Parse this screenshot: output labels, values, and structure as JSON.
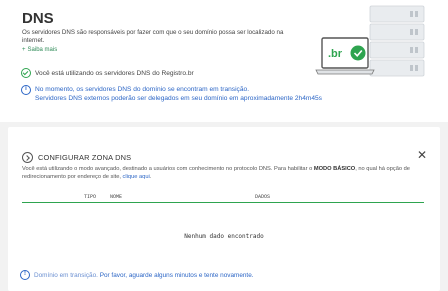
{
  "page": {
    "title": "DNS",
    "description": "Os servidores DNS são responsáveis por fazer com que o seu domínio possa ser localizado na internet.",
    "more_label": "Saiba mais",
    "more_prefix": "+",
    "status_text": "Você está utilizando os servidores DNS do Registro.br",
    "transition_line1": "No momento, os servidores DNS do domínio se encontram em transição.",
    "transition_line2": "Servidores DNS externos poderão ser delegados em seu domínio em aproximadamente 2h4m45s"
  },
  "illustration": {
    "br_label": ".br",
    "accent": "#2ea44f"
  },
  "modal": {
    "title": "CONFIGURAR ZONA DNS",
    "close_glyph": "✕",
    "desc_part1": "Você está utilizando o modo avançado, destinado a usuários com conhecimento no protocolo DNS. Para habilitar o ",
    "desc_bold": "MODO BÁSICO",
    "desc_part2": ", no qual há opção de redirecionamento por endereço de site, ",
    "desc_link": "clique aqui",
    "desc_end": ".",
    "table": {
      "columns": [
        "TIPO",
        "NOME",
        "DADOS"
      ]
    },
    "empty_text": "Nenhum dado encontrado",
    "footer_part1": "Domínio em transição.",
    "footer_part2": " Por favor, aguarde alguns minutos e tente novamente."
  },
  "colors": {
    "green": "#2ea44f",
    "blue": "#2c66c6",
    "background": "#f2f2f2"
  }
}
